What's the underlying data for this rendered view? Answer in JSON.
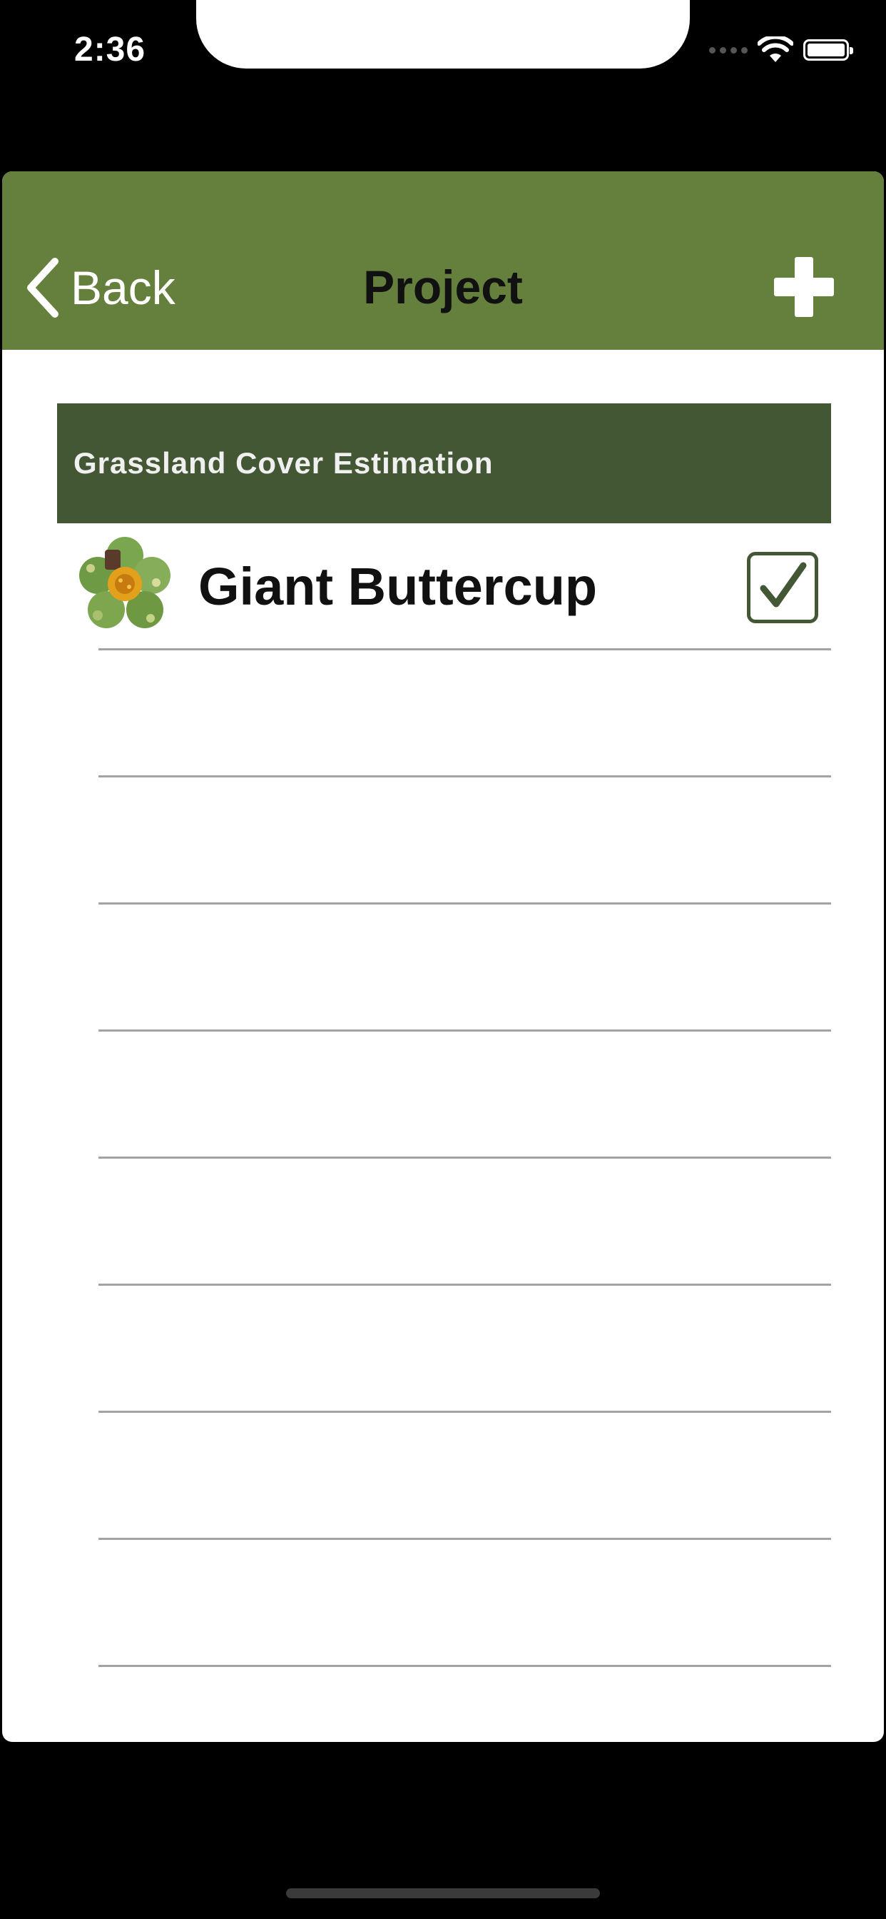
{
  "status_bar": {
    "time": "2:36"
  },
  "nav": {
    "back_label": "Back",
    "title": "Project",
    "add_icon": "plus-icon",
    "back_icon": "chevron-left-icon"
  },
  "section": {
    "title": "Grassland Cover Estimation"
  },
  "species": [
    {
      "name": "Giant Buttercup",
      "checked": true,
      "icon": "buttercup-flower-icon"
    }
  ],
  "colors": {
    "nav_bg": "#65803d",
    "section_bg": "#435734",
    "check_color": "#435734"
  }
}
